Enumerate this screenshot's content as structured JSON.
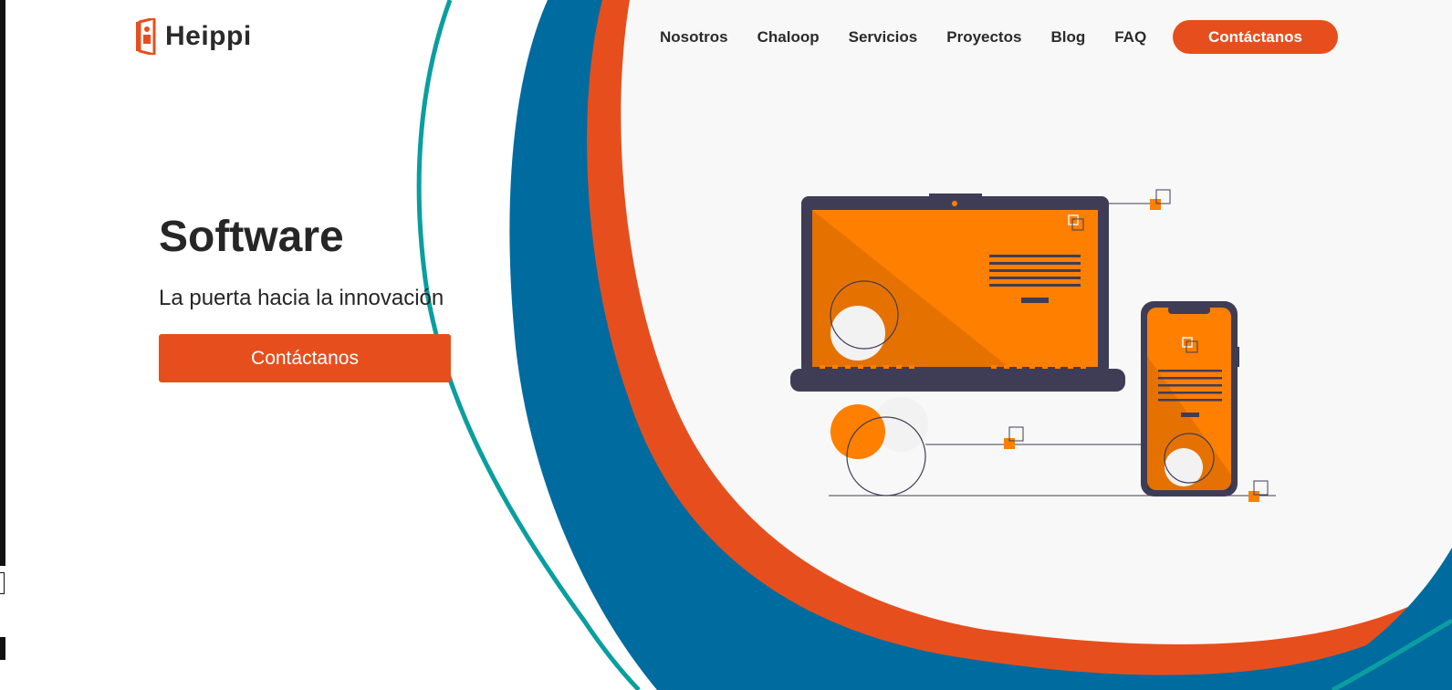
{
  "brand": {
    "name": "Heippi",
    "logo_icon": "door-logo-icon"
  },
  "nav": {
    "items": [
      {
        "label": "Nosotros"
      },
      {
        "label": "Chaloop"
      },
      {
        "label": "Servicios"
      },
      {
        "label": "Proyectos"
      },
      {
        "label": "Blog"
      },
      {
        "label": "FAQ"
      }
    ],
    "cta_label": "Contáctanos"
  },
  "hero": {
    "title": "Software",
    "subtitle": "La puerta hacia la innovación",
    "cta_label": "Contáctanos"
  },
  "colors": {
    "accent": "#e64f1d",
    "blue": "#006b9f",
    "teal": "#0a9ea0",
    "orange_illustration": "#ff7f00",
    "dark_device": "#3f3d56"
  }
}
